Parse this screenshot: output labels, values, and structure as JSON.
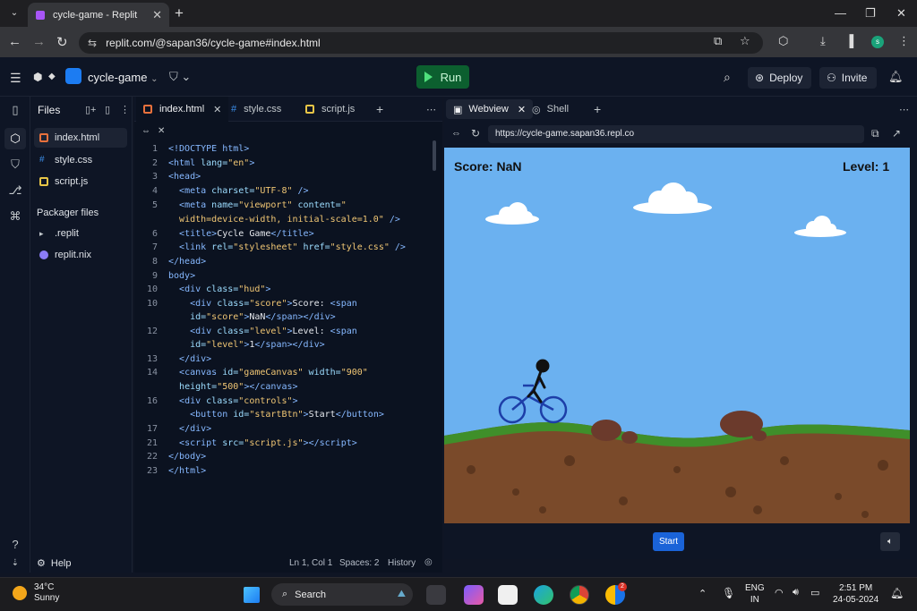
{
  "browser": {
    "tab_title": "cycle-game - Replit",
    "url": "replit.com/@sapan36/cycle-game#index.html",
    "profile_initial": "s"
  },
  "replit": {
    "project_name": "cycle-game",
    "run_label": "Run",
    "deploy_label": "Deploy",
    "invite_label": "Invite"
  },
  "files_panel": {
    "title": "Files",
    "files": [
      {
        "name": "index.html",
        "color": "#e8713c"
      },
      {
        "name": "style.css",
        "color": "#3b8eea"
      },
      {
        "name": "script.js",
        "color": "#e7c547"
      }
    ],
    "packager_title": "Packager files",
    "packager_files": [
      {
        "name": ".replit",
        "color": "#c2c8cc"
      },
      {
        "name": "replit.nix",
        "color": "#8b7cf6"
      }
    ],
    "help_label": "Help"
  },
  "editor": {
    "tabs": [
      {
        "label": "index.html",
        "color": "#e8713c"
      },
      {
        "label": "style.css",
        "color": "#3b8eea"
      },
      {
        "label": "script.js",
        "color": "#e7c547"
      }
    ],
    "line_numbers": [
      "1",
      "2",
      "3",
      "4",
      "5",
      "",
      "6",
      "7",
      "8",
      "9",
      "10",
      "",
      "12",
      "",
      "13",
      "14",
      "",
      "16",
      "17",
      "21",
      "22",
      "23"
    ],
    "status_position": "Ln 1, Col 1",
    "status_spaces": "Spaces: 2",
    "status_history": "History"
  },
  "webview": {
    "tab_webview": "Webview",
    "tab_shell": "Shell",
    "url": "https://cycle-game.sapan36.repl.co",
    "score_label": "Score: NaN",
    "level_label": "Level:  1",
    "start_label": "Start"
  },
  "taskbar": {
    "temperature": "34°C",
    "weather": "Sunny",
    "search_label": "Search",
    "lang_top": "ENG",
    "lang_bottom": "IN",
    "time": "2:51 PM",
    "date": "24-05-2024",
    "badge_count": "2"
  }
}
